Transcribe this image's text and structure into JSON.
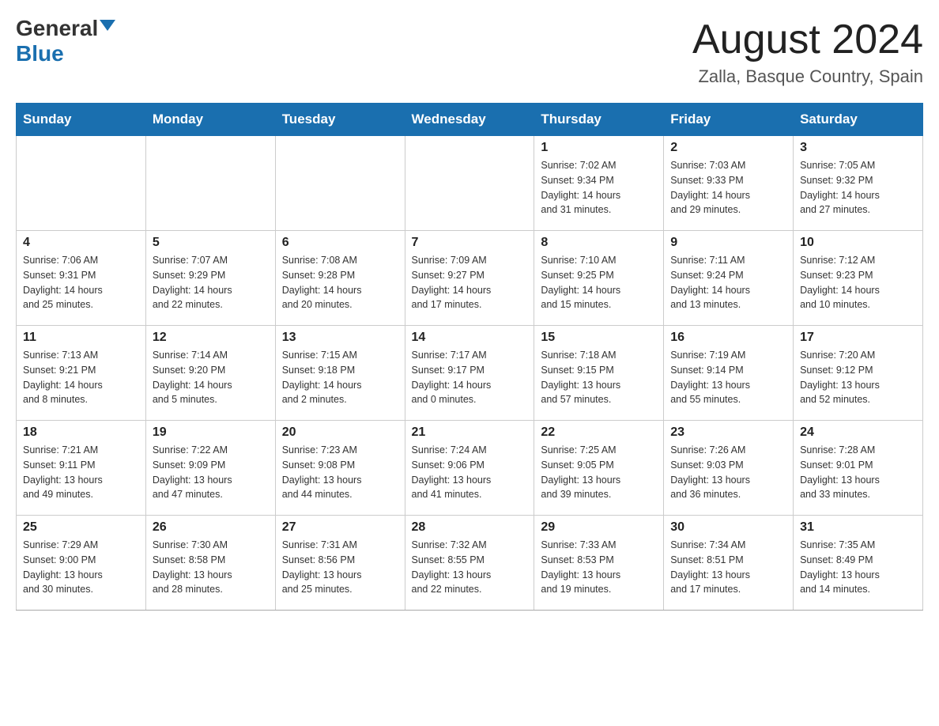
{
  "logo": {
    "general": "General",
    "blue": "Blue"
  },
  "title": "August 2024",
  "location": "Zalla, Basque Country, Spain",
  "weekdays": [
    "Sunday",
    "Monday",
    "Tuesday",
    "Wednesday",
    "Thursday",
    "Friday",
    "Saturday"
  ],
  "weeks": [
    [
      {
        "day": "",
        "info": ""
      },
      {
        "day": "",
        "info": ""
      },
      {
        "day": "",
        "info": ""
      },
      {
        "day": "",
        "info": ""
      },
      {
        "day": "1",
        "info": "Sunrise: 7:02 AM\nSunset: 9:34 PM\nDaylight: 14 hours\nand 31 minutes."
      },
      {
        "day": "2",
        "info": "Sunrise: 7:03 AM\nSunset: 9:33 PM\nDaylight: 14 hours\nand 29 minutes."
      },
      {
        "day": "3",
        "info": "Sunrise: 7:05 AM\nSunset: 9:32 PM\nDaylight: 14 hours\nand 27 minutes."
      }
    ],
    [
      {
        "day": "4",
        "info": "Sunrise: 7:06 AM\nSunset: 9:31 PM\nDaylight: 14 hours\nand 25 minutes."
      },
      {
        "day": "5",
        "info": "Sunrise: 7:07 AM\nSunset: 9:29 PM\nDaylight: 14 hours\nand 22 minutes."
      },
      {
        "day": "6",
        "info": "Sunrise: 7:08 AM\nSunset: 9:28 PM\nDaylight: 14 hours\nand 20 minutes."
      },
      {
        "day": "7",
        "info": "Sunrise: 7:09 AM\nSunset: 9:27 PM\nDaylight: 14 hours\nand 17 minutes."
      },
      {
        "day": "8",
        "info": "Sunrise: 7:10 AM\nSunset: 9:25 PM\nDaylight: 14 hours\nand 15 minutes."
      },
      {
        "day": "9",
        "info": "Sunrise: 7:11 AM\nSunset: 9:24 PM\nDaylight: 14 hours\nand 13 minutes."
      },
      {
        "day": "10",
        "info": "Sunrise: 7:12 AM\nSunset: 9:23 PM\nDaylight: 14 hours\nand 10 minutes."
      }
    ],
    [
      {
        "day": "11",
        "info": "Sunrise: 7:13 AM\nSunset: 9:21 PM\nDaylight: 14 hours\nand 8 minutes."
      },
      {
        "day": "12",
        "info": "Sunrise: 7:14 AM\nSunset: 9:20 PM\nDaylight: 14 hours\nand 5 minutes."
      },
      {
        "day": "13",
        "info": "Sunrise: 7:15 AM\nSunset: 9:18 PM\nDaylight: 14 hours\nand 2 minutes."
      },
      {
        "day": "14",
        "info": "Sunrise: 7:17 AM\nSunset: 9:17 PM\nDaylight: 14 hours\nand 0 minutes."
      },
      {
        "day": "15",
        "info": "Sunrise: 7:18 AM\nSunset: 9:15 PM\nDaylight: 13 hours\nand 57 minutes."
      },
      {
        "day": "16",
        "info": "Sunrise: 7:19 AM\nSunset: 9:14 PM\nDaylight: 13 hours\nand 55 minutes."
      },
      {
        "day": "17",
        "info": "Sunrise: 7:20 AM\nSunset: 9:12 PM\nDaylight: 13 hours\nand 52 minutes."
      }
    ],
    [
      {
        "day": "18",
        "info": "Sunrise: 7:21 AM\nSunset: 9:11 PM\nDaylight: 13 hours\nand 49 minutes."
      },
      {
        "day": "19",
        "info": "Sunrise: 7:22 AM\nSunset: 9:09 PM\nDaylight: 13 hours\nand 47 minutes."
      },
      {
        "day": "20",
        "info": "Sunrise: 7:23 AM\nSunset: 9:08 PM\nDaylight: 13 hours\nand 44 minutes."
      },
      {
        "day": "21",
        "info": "Sunrise: 7:24 AM\nSunset: 9:06 PM\nDaylight: 13 hours\nand 41 minutes."
      },
      {
        "day": "22",
        "info": "Sunrise: 7:25 AM\nSunset: 9:05 PM\nDaylight: 13 hours\nand 39 minutes."
      },
      {
        "day": "23",
        "info": "Sunrise: 7:26 AM\nSunset: 9:03 PM\nDaylight: 13 hours\nand 36 minutes."
      },
      {
        "day": "24",
        "info": "Sunrise: 7:28 AM\nSunset: 9:01 PM\nDaylight: 13 hours\nand 33 minutes."
      }
    ],
    [
      {
        "day": "25",
        "info": "Sunrise: 7:29 AM\nSunset: 9:00 PM\nDaylight: 13 hours\nand 30 minutes."
      },
      {
        "day": "26",
        "info": "Sunrise: 7:30 AM\nSunset: 8:58 PM\nDaylight: 13 hours\nand 28 minutes."
      },
      {
        "day": "27",
        "info": "Sunrise: 7:31 AM\nSunset: 8:56 PM\nDaylight: 13 hours\nand 25 minutes."
      },
      {
        "day": "28",
        "info": "Sunrise: 7:32 AM\nSunset: 8:55 PM\nDaylight: 13 hours\nand 22 minutes."
      },
      {
        "day": "29",
        "info": "Sunrise: 7:33 AM\nSunset: 8:53 PM\nDaylight: 13 hours\nand 19 minutes."
      },
      {
        "day": "30",
        "info": "Sunrise: 7:34 AM\nSunset: 8:51 PM\nDaylight: 13 hours\nand 17 minutes."
      },
      {
        "day": "31",
        "info": "Sunrise: 7:35 AM\nSunset: 8:49 PM\nDaylight: 13 hours\nand 14 minutes."
      }
    ]
  ]
}
